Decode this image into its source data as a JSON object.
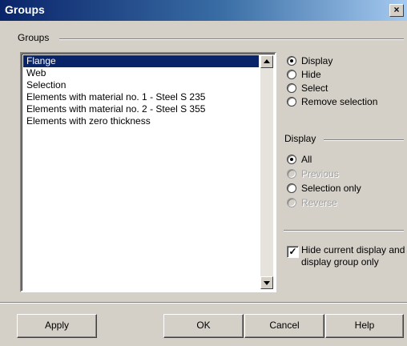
{
  "window": {
    "title": "Groups",
    "close_label": "×"
  },
  "groups": {
    "label": "Groups",
    "items": [
      "Flange",
      "Web",
      "Selection",
      "Elements with material no. 1 - Steel S 235",
      "Elements with material no. 2 - Steel S 355",
      "Elements with zero thickness"
    ],
    "selected_index": 0
  },
  "action_options": [
    {
      "label": "Display",
      "checked": true
    },
    {
      "label": "Hide",
      "checked": false
    },
    {
      "label": "Select",
      "checked": false
    },
    {
      "label": "Remove selection",
      "checked": false
    }
  ],
  "display": {
    "label": "Display",
    "options": [
      {
        "label": "All",
        "checked": true,
        "enabled": true
      },
      {
        "label": "Previous",
        "checked": false,
        "enabled": false
      },
      {
        "label": "Selection only",
        "checked": false,
        "enabled": true
      },
      {
        "label": "Reverse",
        "checked": false,
        "enabled": false
      }
    ]
  },
  "hide_current": {
    "label": "Hide current display and display group only",
    "checked": true,
    "mark": "✓"
  },
  "buttons": {
    "apply": "Apply",
    "ok": "OK",
    "cancel": "Cancel",
    "help": "Help"
  }
}
